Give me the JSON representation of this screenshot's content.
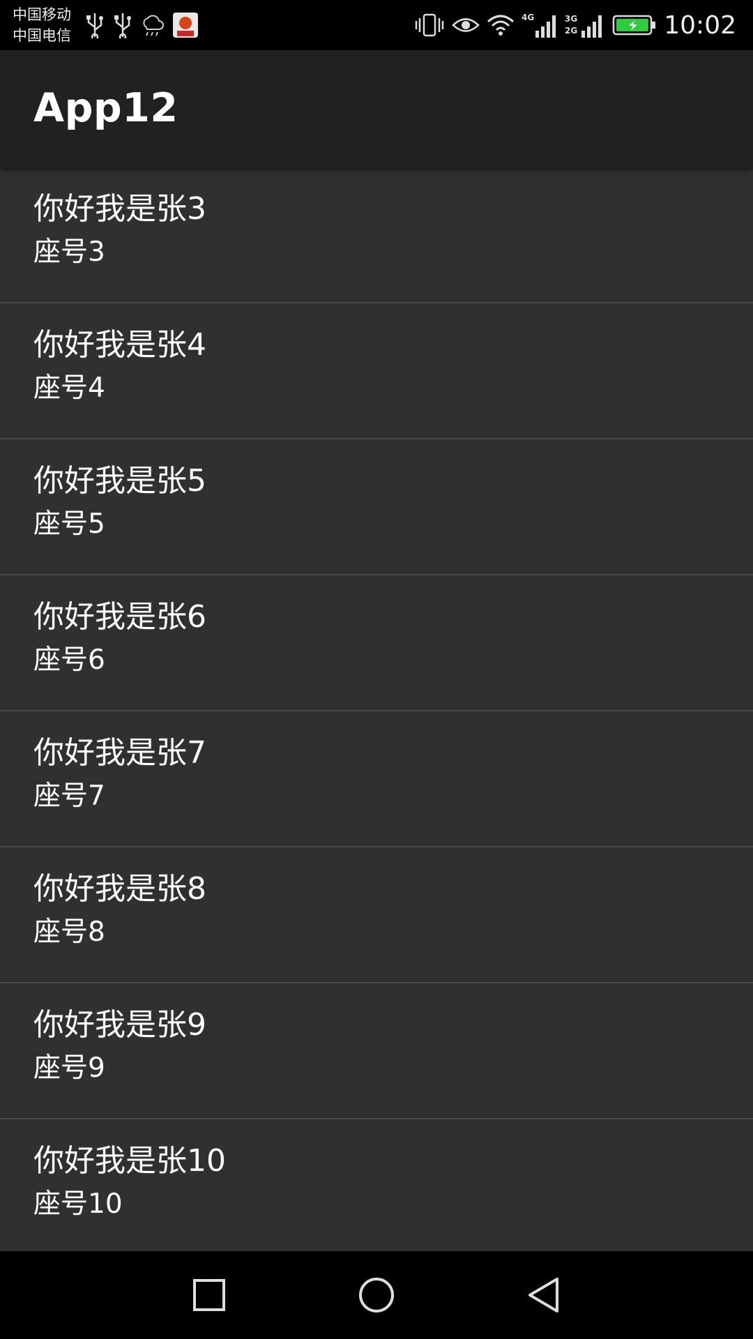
{
  "status_bar": {
    "carrier_1": "中国移动",
    "carrier_2": "中国电信",
    "time": "10:02",
    "network_labels": [
      "4G",
      "3G",
      "2G"
    ],
    "icons_left": [
      "usb-icon",
      "usb-icon",
      "weather-cloud-icon",
      "app-notification-icon"
    ],
    "icons_right": [
      "vibrate-icon",
      "eye-comfort-icon",
      "wifi-icon",
      "signal-4g-icon",
      "signal-3g-2g-icon",
      "battery-charging-icon"
    ],
    "battery_level": 1.0,
    "battery_color": "#2ecc40"
  },
  "app_bar": {
    "title": "App12"
  },
  "list": {
    "items": [
      {
        "title": "你好我是张3",
        "seat": "座号3"
      },
      {
        "title": "你好我是张4",
        "seat": "座号4"
      },
      {
        "title": "你好我是张5",
        "seat": "座号5"
      },
      {
        "title": "你好我是张6",
        "seat": "座号6"
      },
      {
        "title": "你好我是张7",
        "seat": "座号7"
      },
      {
        "title": "你好我是张8",
        "seat": "座号8"
      },
      {
        "title": "你好我是张9",
        "seat": "座号9"
      },
      {
        "title": "你好我是张10",
        "seat": "座号10"
      }
    ]
  },
  "nav_bar": {
    "buttons": [
      "recents-square-icon",
      "home-circle-icon",
      "back-triangle-icon"
    ]
  },
  "colors": {
    "app_bar_bg": "#212121",
    "list_bg": "#303030",
    "divider": "#4a4a4a",
    "text": "#ffffff"
  }
}
